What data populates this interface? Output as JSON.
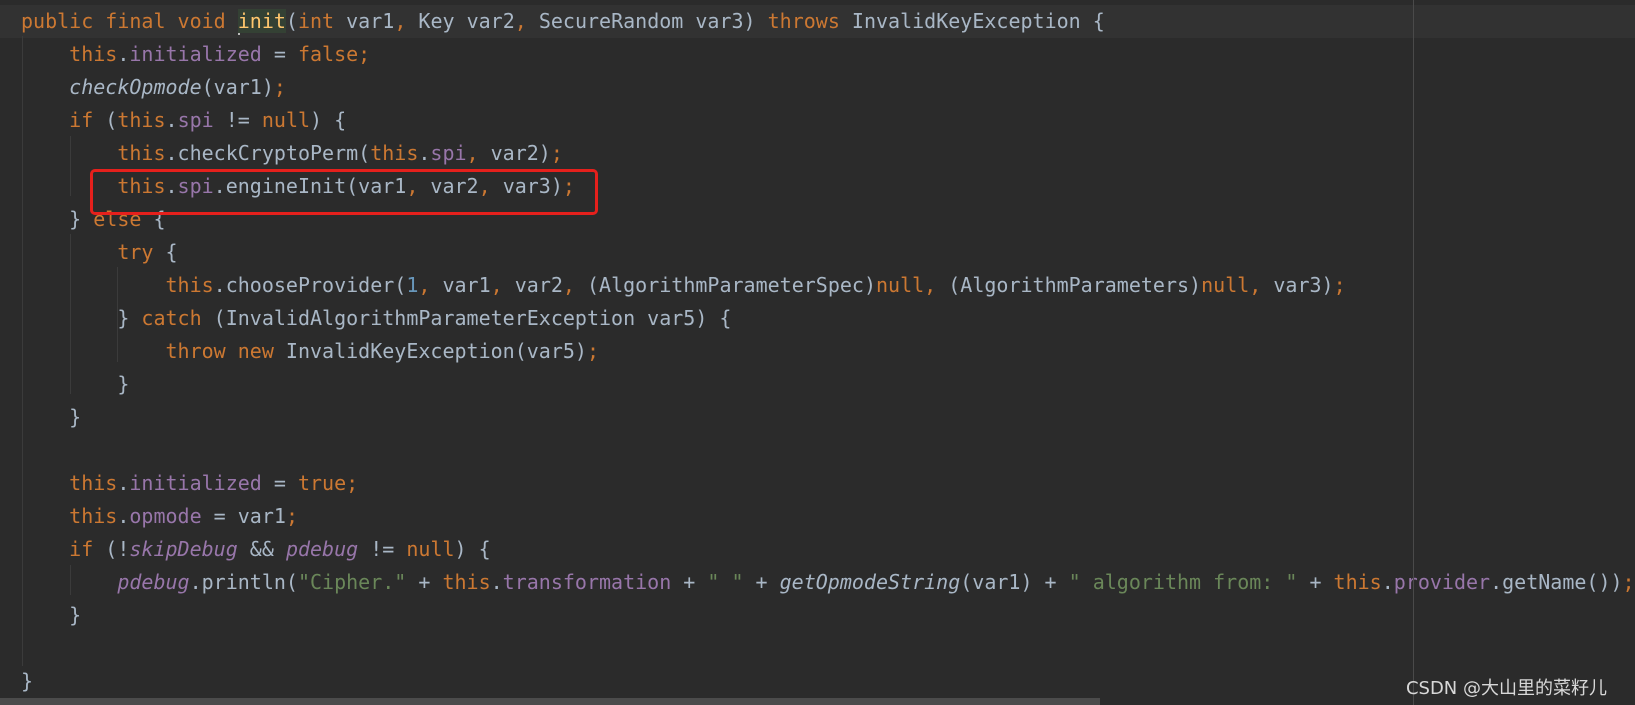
{
  "editor": {
    "theme_colors": {
      "background": "#2b2b2b",
      "keyword": "#cc7832",
      "field": "#9876aa",
      "string": "#6a8759",
      "number": "#6897bb",
      "default": "#a9b7c6",
      "highlight_box": "#e5201c"
    },
    "highlighted_line": 6,
    "lines": [
      [
        [
          "k",
          "public final void "
        ],
        [
          "m",
          "init"
        ],
        [
          "",
          "("
        ],
        [
          "k",
          "int "
        ],
        [
          "",
          "var1"
        ],
        [
          "k",
          ", "
        ],
        [
          "",
          "Key var2"
        ],
        [
          "k",
          ", "
        ],
        [
          "",
          "SecureRandom var3) "
        ],
        [
          "k",
          "throws "
        ],
        [
          "",
          "InvalidKeyException {"
        ]
      ],
      [
        [
          "",
          "    "
        ],
        [
          "k",
          "this"
        ],
        [
          "",
          "."
        ],
        [
          "f",
          "initialized"
        ],
        [
          "",
          " = "
        ],
        [
          "k",
          "false;"
        ]
      ],
      [
        [
          "",
          "    "
        ],
        [
          "i",
          "checkOpmode"
        ],
        [
          "",
          "(var1)"
        ],
        [
          "k",
          ";"
        ]
      ],
      [
        [
          "",
          "    "
        ],
        [
          "k",
          "if "
        ],
        [
          "",
          "("
        ],
        [
          "k",
          "this"
        ],
        [
          "",
          "."
        ],
        [
          "f",
          "spi"
        ],
        [
          "",
          " != "
        ],
        [
          "k",
          "null"
        ],
        [
          "",
          ") {"
        ]
      ],
      [
        [
          "",
          "        "
        ],
        [
          "k",
          "this"
        ],
        [
          "",
          ".checkCryptoPerm("
        ],
        [
          "k",
          "this"
        ],
        [
          "",
          "."
        ],
        [
          "f",
          "spi"
        ],
        [
          "k",
          ", "
        ],
        [
          "",
          "var2)"
        ],
        [
          "k",
          ";"
        ]
      ],
      [
        [
          "",
          "        "
        ],
        [
          "k",
          "this"
        ],
        [
          "",
          "."
        ],
        [
          "f",
          "spi"
        ],
        [
          "",
          ".engineInit(var1"
        ],
        [
          "k",
          ", "
        ],
        [
          "",
          "var2"
        ],
        [
          "k",
          ", "
        ],
        [
          "",
          "var3)"
        ],
        [
          "k",
          ";"
        ]
      ],
      [
        [
          "",
          "    } "
        ],
        [
          "k",
          "else "
        ],
        [
          "",
          "{"
        ]
      ],
      [
        [
          "",
          "        "
        ],
        [
          "k",
          "try "
        ],
        [
          "",
          "{"
        ]
      ],
      [
        [
          "",
          "            "
        ],
        [
          "k",
          "this"
        ],
        [
          "",
          ".chooseProvider("
        ],
        [
          "n",
          "1"
        ],
        [
          "k",
          ", "
        ],
        [
          "",
          "var1"
        ],
        [
          "k",
          ", "
        ],
        [
          "",
          "var2"
        ],
        [
          "k",
          ", "
        ],
        [
          "",
          "(AlgorithmParameterSpec)"
        ],
        [
          "k",
          "null, "
        ],
        [
          "",
          "(AlgorithmParameters)"
        ],
        [
          "k",
          "null, "
        ],
        [
          "",
          "var3)"
        ],
        [
          "k",
          ";"
        ]
      ],
      [
        [
          "",
          "        } "
        ],
        [
          "k",
          "catch "
        ],
        [
          "",
          "(InvalidAlgorithmParameterException var5) {"
        ]
      ],
      [
        [
          "",
          "            "
        ],
        [
          "k",
          "throw new "
        ],
        [
          "",
          "InvalidKeyException(var5)"
        ],
        [
          "k",
          ";"
        ]
      ],
      [
        [
          "",
          "        }"
        ]
      ],
      [
        [
          "",
          "    }"
        ]
      ],
      [
        [
          "",
          ""
        ]
      ],
      [
        [
          "",
          "    "
        ],
        [
          "k",
          "this"
        ],
        [
          "",
          "."
        ],
        [
          "f",
          "initialized"
        ],
        [
          "",
          " = "
        ],
        [
          "k",
          "true;"
        ]
      ],
      [
        [
          "",
          "    "
        ],
        [
          "k",
          "this"
        ],
        [
          "",
          "."
        ],
        [
          "f",
          "opmode"
        ],
        [
          "",
          " = var1"
        ],
        [
          "k",
          ";"
        ]
      ],
      [
        [
          "",
          "    "
        ],
        [
          "k",
          "if "
        ],
        [
          "",
          "(!"
        ],
        [
          "fi",
          "skipDebug"
        ],
        [
          "",
          " && "
        ],
        [
          "fi",
          "pdebug"
        ],
        [
          "",
          " != "
        ],
        [
          "k",
          "null"
        ],
        [
          "",
          ") {"
        ]
      ],
      [
        [
          "",
          "        "
        ],
        [
          "fi",
          "pdebug"
        ],
        [
          "",
          ".println("
        ],
        [
          "s",
          "\"Cipher.\""
        ],
        [
          "",
          " + "
        ],
        [
          "k",
          "this"
        ],
        [
          "",
          "."
        ],
        [
          "f",
          "transformation"
        ],
        [
          "",
          " + "
        ],
        [
          "s",
          "\" \""
        ],
        [
          "",
          " + "
        ],
        [
          "i",
          "getOpmodeString"
        ],
        [
          "",
          "(var1) + "
        ],
        [
          "s",
          "\" algorithm from: \""
        ],
        [
          "",
          " + "
        ],
        [
          "k",
          "this"
        ],
        [
          "",
          "."
        ],
        [
          "f",
          "provider"
        ],
        [
          "",
          ".getName())"
        ],
        [
          "k",
          ";"
        ]
      ],
      [
        [
          "",
          "    }"
        ]
      ],
      [
        [
          "",
          ""
        ]
      ],
      [
        [
          "",
          "}"
        ]
      ]
    ]
  },
  "watermark": "CSDN @大山里的菜籽儿"
}
